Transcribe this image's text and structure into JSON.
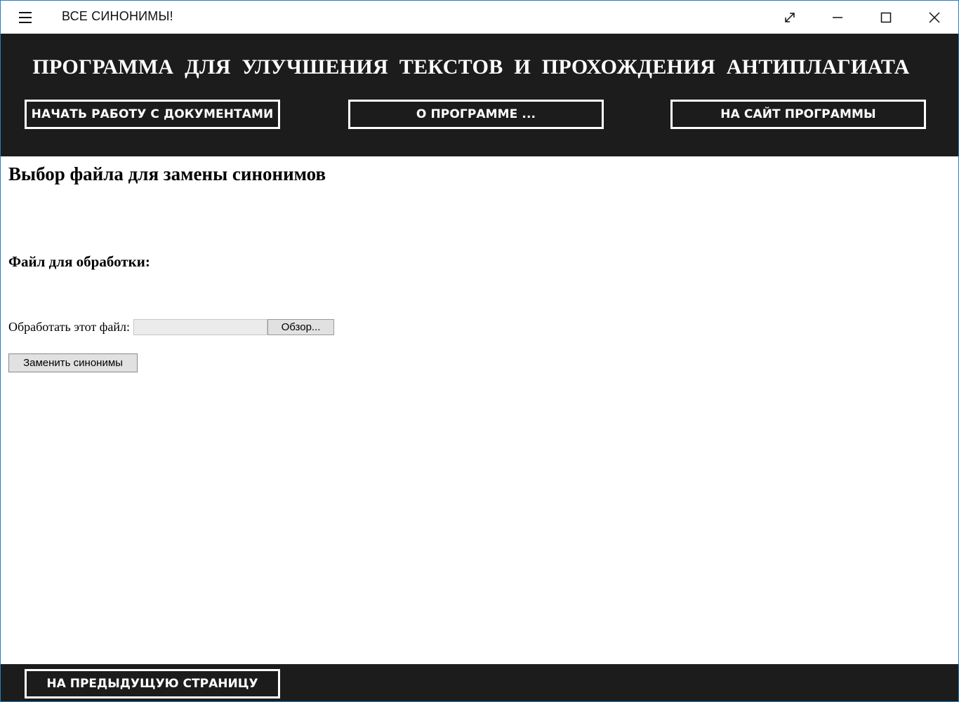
{
  "window": {
    "title": "ВСЕ СИНОНИМЫ!",
    "controls": [
      "expand-icon",
      "minimize-icon",
      "maximize-icon",
      "close-icon"
    ]
  },
  "header": {
    "headline": "ПРОГРАММА ДЛЯ УЛУЧШЕНИЯ ТЕКСТОВ И ПРОХОЖДЕНИЯ АНТИПЛАГИАТА",
    "nav": {
      "documents": "НАЧАТЬ РАБОТУ С ДОКУМЕНТАМИ",
      "about": "О ПРОГРАММЕ ...",
      "site": "НА САЙТ ПРОГРАММЫ"
    }
  },
  "main": {
    "title": "Выбор файла для замены синонимов",
    "section_title": "Файл для обработки:",
    "file_label": "Обработать этот файл:",
    "file_value": "",
    "browse_label": "Обзор...",
    "submit_label": "Заменить синонимы"
  },
  "footer": {
    "back_label": "НА ПРЕДЫДУЩУЮ СТРАНИЦУ"
  },
  "colors": {
    "band": "#1c1c1c",
    "window_border": "#1f7fc8",
    "button_face": "#e1e1e1"
  }
}
